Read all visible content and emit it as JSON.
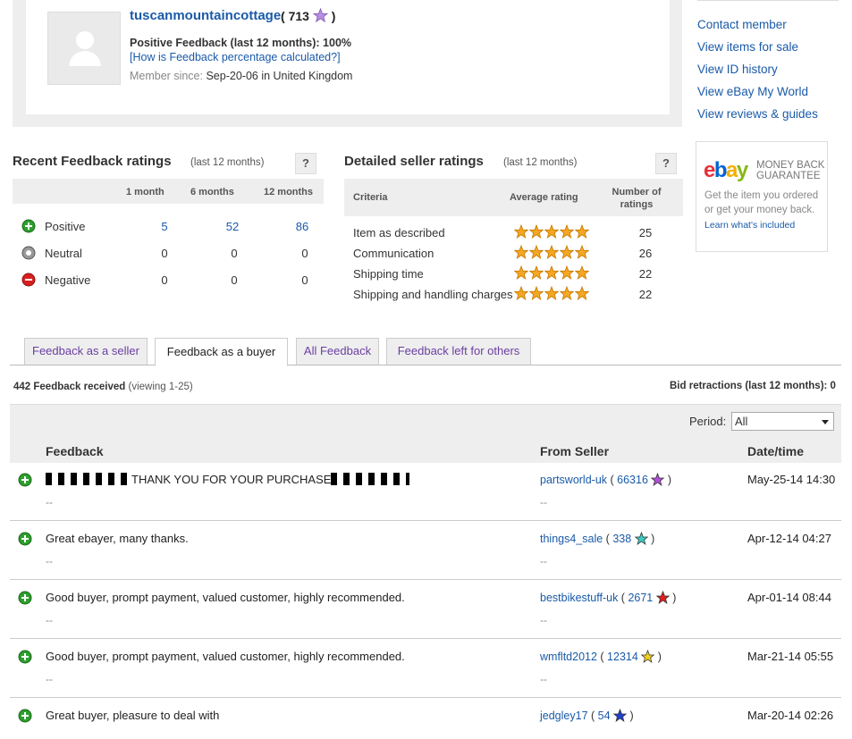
{
  "profile": {
    "username": "tuscanmountaincottage",
    "score": "713",
    "positive_feedback": "Positive Feedback (last 12 months): 100%",
    "how_link": "[How is Feedback percentage calculated?]",
    "member_since_label": "Member since:",
    "member_since_value": "Sep-20-06 in United Kingdom"
  },
  "side_links": [
    "Contact member",
    "View items for sale",
    "View ID history",
    "View eBay My World",
    "View reviews & guides"
  ],
  "guarantee": {
    "logo": "ebay",
    "title_line1": "MONEY BACK",
    "title_line2": "GUARANTEE",
    "text": "Get the item you ordered or get your money back.",
    "link": "Learn what's included"
  },
  "recent_ratings": {
    "title": "Recent Feedback ratings",
    "subtitle": "(last 12 months)",
    "help": "?",
    "columns": [
      "1 month",
      "6 months",
      "12 months"
    ],
    "rows": [
      {
        "label": "Positive",
        "values": [
          "5",
          "52",
          "86"
        ],
        "icon": "positive-icon"
      },
      {
        "label": "Neutral",
        "values": [
          "0",
          "0",
          "0"
        ],
        "icon": "neutral-icon"
      },
      {
        "label": "Negative",
        "values": [
          "0",
          "0",
          "0"
        ],
        "icon": "negative-icon"
      }
    ]
  },
  "detailed_ratings": {
    "title": "Detailed seller ratings",
    "subtitle": "(last 12 months)",
    "help": "?",
    "col_criteria": "Criteria",
    "col_average": "Average rating",
    "col_number_line1": "Number of",
    "col_number_line2": "ratings",
    "rows": [
      {
        "criteria": "Item as described",
        "stars": 5,
        "count": "25"
      },
      {
        "criteria": "Communication",
        "stars": 5,
        "count": "26"
      },
      {
        "criteria": "Shipping time",
        "stars": 5,
        "count": "22"
      },
      {
        "criteria": "Shipping and handling charges",
        "stars": 5,
        "count": "22"
      }
    ]
  },
  "tabs": [
    "Feedback as a seller",
    "Feedback as a buyer",
    "All Feedback",
    "Feedback left for others"
  ],
  "active_tab": 1,
  "received": {
    "count": "442 Feedback received",
    "viewing": "(viewing 1-25)"
  },
  "bid_retractions": "Bid retractions (last 12 months): 0",
  "period": {
    "label": "Period:",
    "value": "All"
  },
  "list_headers": {
    "feedback": "Feedback",
    "from": "From Seller",
    "date": "Date/time"
  },
  "feedback": [
    {
      "text": "THANK YOU FOR YOUR PURCHASE",
      "dash": "--",
      "seller": "partsworld-uk",
      "score": "66316",
      "star_color": "#b04fd8",
      "seller_dash": "--",
      "date": "May-25-14 14:30"
    },
    {
      "text": "Great ebayer, many thanks.",
      "dash": "--",
      "seller": "things4_sale",
      "score": "338",
      "star_color": "#3cc9c0",
      "seller_dash": "--",
      "date": "Apr-12-14 04:27"
    },
    {
      "text": "Good buyer, prompt payment, valued customer, highly recommended.",
      "dash": "--",
      "seller": "bestbikestuff-uk",
      "score": "2671",
      "star_color": "#e02020",
      "seller_dash": "--",
      "date": "Apr-01-14 08:44"
    },
    {
      "text": "Good buyer, prompt payment, valued customer, highly recommended.",
      "dash": "--",
      "seller": "wmfltd2012",
      "score": "12314",
      "star_color": "#f0d020",
      "seller_dash": "--",
      "date": "Mar-21-14 05:55"
    },
    {
      "text": "Great buyer, pleasure to deal with",
      "dash": "",
      "seller": "jedgley17",
      "score": "54",
      "star_color": "#1f3fd0",
      "seller_dash": "",
      "date": "Mar-20-14 02:26"
    }
  ]
}
